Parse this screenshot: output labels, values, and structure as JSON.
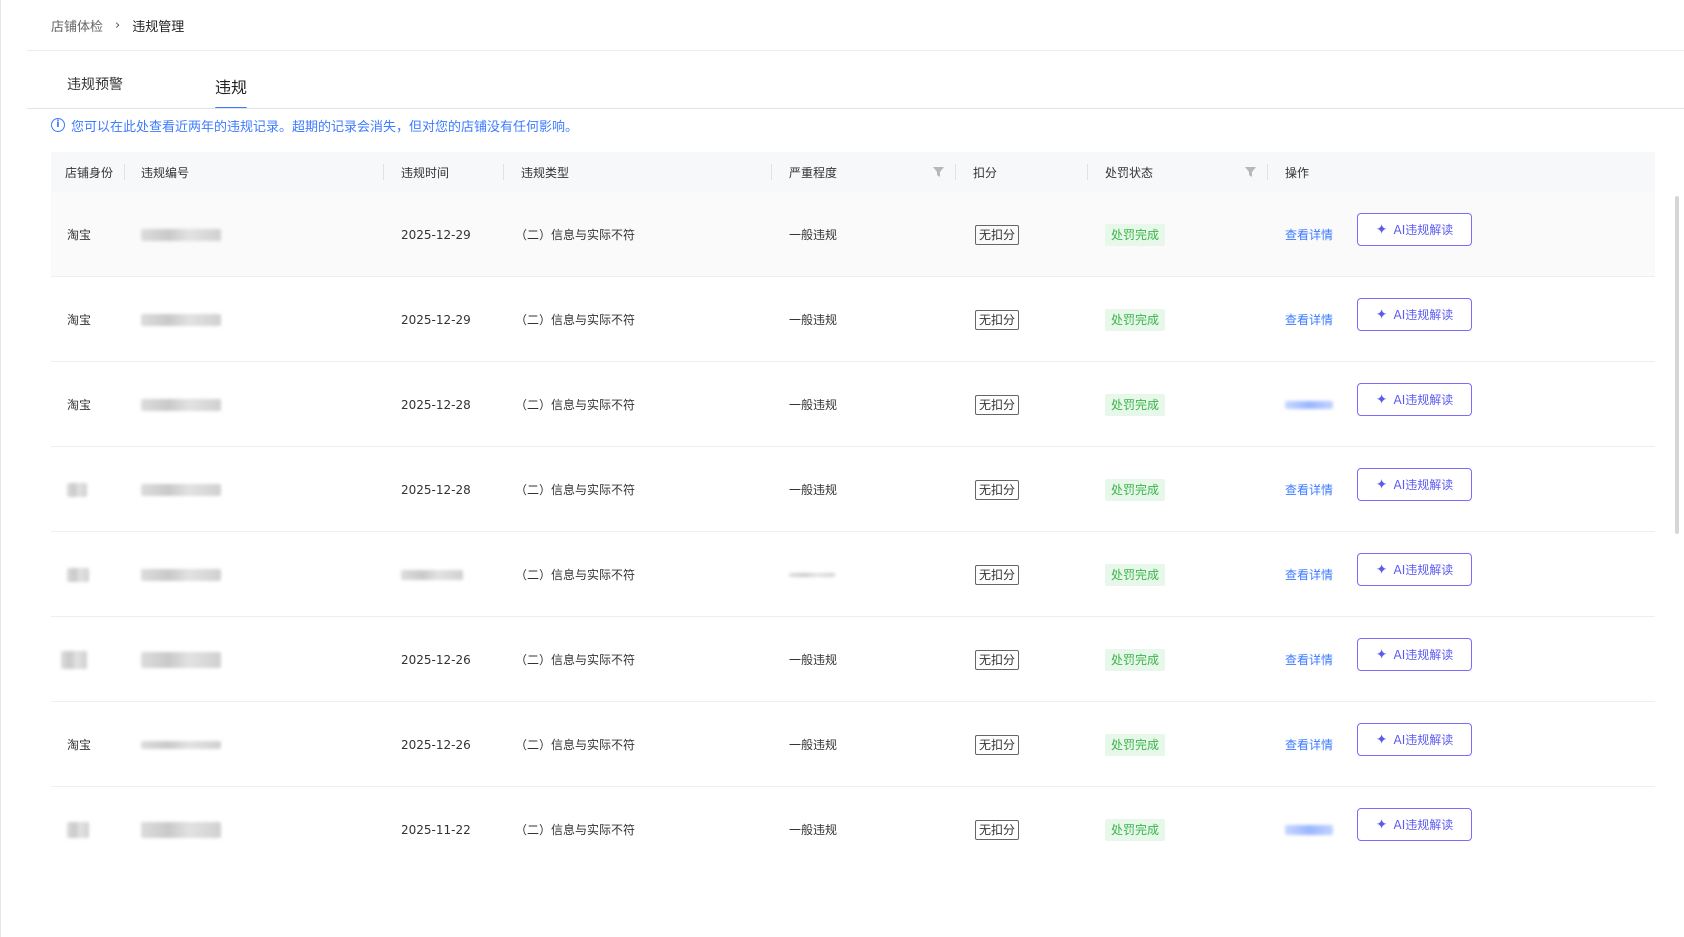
{
  "breadcrumb": {
    "items": [
      "店铺体检",
      "违规管理"
    ],
    "separator": "›"
  },
  "tabs": [
    {
      "label": "违规预警",
      "active": false
    },
    {
      "label": "违规",
      "active": true
    }
  ],
  "notice": {
    "text": "您可以在此处查看近两年的违规记录。超期的记录会消失，但对您的店铺没有任何影响。"
  },
  "table": {
    "columns": {
      "identity": "店铺身份",
      "number": "违规编号",
      "time": "违规时间",
      "type": "违规类型",
      "severity": "严重程度",
      "score": "扣分",
      "status": "处罚状态",
      "action": "操作"
    },
    "rows": [
      {
        "identity": "淘宝",
        "time": "2025-12-29",
        "type": "（二）信息与实际不符",
        "severity": "一般违规",
        "score": "无扣分",
        "status": "处罚完成",
        "detail": "查看详情",
        "ai": "AI违规解读"
      },
      {
        "identity": "淘宝",
        "time": "2025-12-29",
        "type": "（二）信息与实际不符",
        "severity": "一般违规",
        "score": "无扣分",
        "status": "处罚完成",
        "detail": "查看详情",
        "ai": "AI违规解读"
      },
      {
        "identity": "淘宝",
        "time": "2025-12-28",
        "type": "（二）信息与实际不符",
        "severity": "一般违规",
        "score": "无扣分",
        "status": "处罚完成",
        "detail": "",
        "ai": "AI违规解读"
      },
      {
        "identity": "",
        "time": "2025-12-28",
        "type": "（二）信息与实际不符",
        "severity": "一般违规",
        "score": "无扣分",
        "status": "处罚完成",
        "detail": "查看详情",
        "ai": "AI违规解读"
      },
      {
        "identity": "",
        "time": "",
        "type": "（二）信息与实际不符",
        "severity": "",
        "score": "无扣分",
        "status": "处罚完成",
        "detail": "查看详情",
        "ai": "AI违规解读"
      },
      {
        "identity": "",
        "time": "2025-12-26",
        "type": "（二）信息与实际不符",
        "severity": "一般违规",
        "score": "无扣分",
        "status": "处罚完成",
        "detail": "查看详情",
        "ai": "AI违规解读"
      },
      {
        "identity": "淘宝",
        "time": "2025-12-26",
        "type": "（二）信息与实际不符",
        "severity": "一般违规",
        "score": "无扣分",
        "status": "处罚完成",
        "detail": "查看详情",
        "ai": "AI违规解读"
      },
      {
        "identity": "",
        "time": "2025-11-22",
        "type": "（二）信息与实际不符",
        "severity": "一般违规",
        "score": "无扣分",
        "status": "处罚完成",
        "detail": "",
        "ai": "AI违规解读"
      }
    ]
  },
  "colors": {
    "accent": "#3d7bff",
    "status_green": "#3bb54a",
    "status_bg": "#e7f8ea",
    "ai_border": "#7a6cff"
  },
  "icons": {
    "info": "info-circle-icon",
    "filter": "filter-icon",
    "ai": "sparkle-icon"
  }
}
